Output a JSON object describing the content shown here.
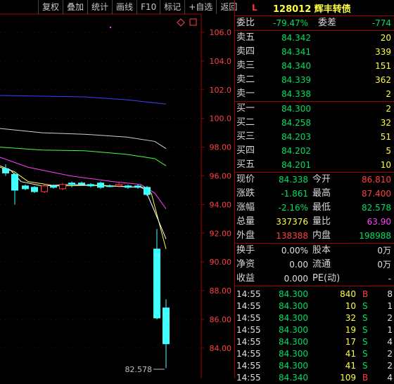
{
  "toolbar": [
    "复权",
    "叠加",
    "统计",
    "画线",
    "F10",
    "标记",
    "+自选",
    "返回"
  ],
  "axis": {
    "ticks": [
      "106.0",
      "104.0",
      "102.0",
      "100.0",
      "98.00",
      "96.00",
      "94.00",
      "92.00",
      "90.00",
      "88.00",
      "86.00",
      "84.00"
    ],
    "low_label": "82.578"
  },
  "header": {
    "flag": "L",
    "title": "128012 辉丰转债"
  },
  "ratio": {
    "l1": "委比",
    "v1": "-79.47%",
    "l2": "委差",
    "v2": "-774"
  },
  "asks": [
    {
      "label": "卖五",
      "price": "84.342",
      "vol": "20"
    },
    {
      "label": "卖四",
      "price": "84.341",
      "vol": "339"
    },
    {
      "label": "卖三",
      "price": "84.340",
      "vol": "151"
    },
    {
      "label": "卖二",
      "price": "84.339",
      "vol": "362"
    },
    {
      "label": "卖一",
      "price": "84.338",
      "vol": "2"
    }
  ],
  "bids": [
    {
      "label": "买一",
      "price": "84.300",
      "vol": "2"
    },
    {
      "label": "买二",
      "price": "84.258",
      "vol": "32"
    },
    {
      "label": "买三",
      "price": "84.203",
      "vol": "51"
    },
    {
      "label": "买四",
      "price": "84.202",
      "vol": "5"
    },
    {
      "label": "买五",
      "price": "84.201",
      "vol": "10"
    }
  ],
  "stats": [
    {
      "l1": "现价",
      "v1": "84.338",
      "c1": "g",
      "l2": "今开",
      "v2": "86.810",
      "c2": "r"
    },
    {
      "l1": "涨跌",
      "v1": "-1.861",
      "c1": "g",
      "l2": "最高",
      "v2": "87.400",
      "c2": "r"
    },
    {
      "l1": "涨幅",
      "v1": "-2.16%",
      "c1": "g",
      "l2": "最低",
      "v2": "82.578",
      "c2": "g"
    },
    {
      "l1": "总量",
      "v1": "337376",
      "c1": "y",
      "l2": "量比",
      "v2": "63.90",
      "c2": "m"
    },
    {
      "l1": "外盘",
      "v1": "138388",
      "c1": "r",
      "l2": "内盘",
      "v2": "198988",
      "c2": "g"
    }
  ],
  "info": [
    {
      "l1": "换手",
      "v1": "0.00%",
      "l2": "股本",
      "v2": "0万"
    },
    {
      "l1": "净资",
      "v1": "0.00",
      "l2": "流通",
      "v2": "0万"
    },
    {
      "l1": "收益",
      "v1": "0.000",
      "l2": "PE(动)",
      "v2": "-"
    }
  ],
  "ticks": [
    {
      "t": "14:55",
      "p": "84.300",
      "v": "840",
      "s": "B",
      "n": "8"
    },
    {
      "t": "14:55",
      "p": "84.300",
      "v": "10",
      "s": "S",
      "n": "1"
    },
    {
      "t": "14:55",
      "p": "84.300",
      "v": "32",
      "s": "S",
      "n": "2"
    },
    {
      "t": "14:55",
      "p": "84.300",
      "v": "19",
      "s": "S",
      "n": "1"
    },
    {
      "t": "14:55",
      "p": "84.300",
      "v": "17",
      "s": "S",
      "n": "4"
    },
    {
      "t": "14:55",
      "p": "84.300",
      "v": "41",
      "s": "S",
      "n": "2"
    },
    {
      "t": "14:55",
      "p": "84.300",
      "v": "41",
      "s": "S",
      "n": "2"
    },
    {
      "t": "14:55",
      "p": "84.340",
      "v": "109",
      "s": "B",
      "n": "4"
    }
  ],
  "colors": {
    "up": "#ff4040",
    "down": "#00e060",
    "candle_down": "#40ffff",
    "accent": "#ffff40"
  }
}
